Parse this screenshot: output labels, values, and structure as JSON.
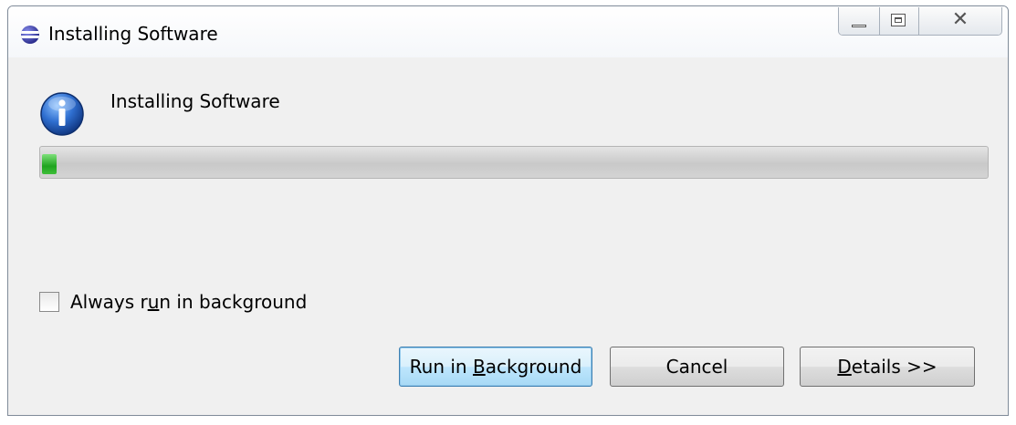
{
  "window": {
    "title": "Installing Software"
  },
  "dialog": {
    "heading": "Installing Software",
    "progress": 0.015
  },
  "checkbox": {
    "label_pre": "Always r",
    "label_mnemonic": "u",
    "label_post": "n in background",
    "checked": false
  },
  "buttons": {
    "run_pre": "Run in ",
    "run_mnemonic": "B",
    "run_post": "ackground",
    "cancel": "Cancel",
    "details_mnemonic": "D",
    "details_post": "etails >>"
  },
  "icons": {
    "app": "eclipse-icon",
    "info": "info-icon",
    "minimize": "minimize-icon",
    "maximize": "maximize-icon",
    "close": "close-icon"
  },
  "colors": {
    "progress_fill": "#1fa41f",
    "default_button": "#bee6fd",
    "info_icon": "#1f5fbf"
  }
}
